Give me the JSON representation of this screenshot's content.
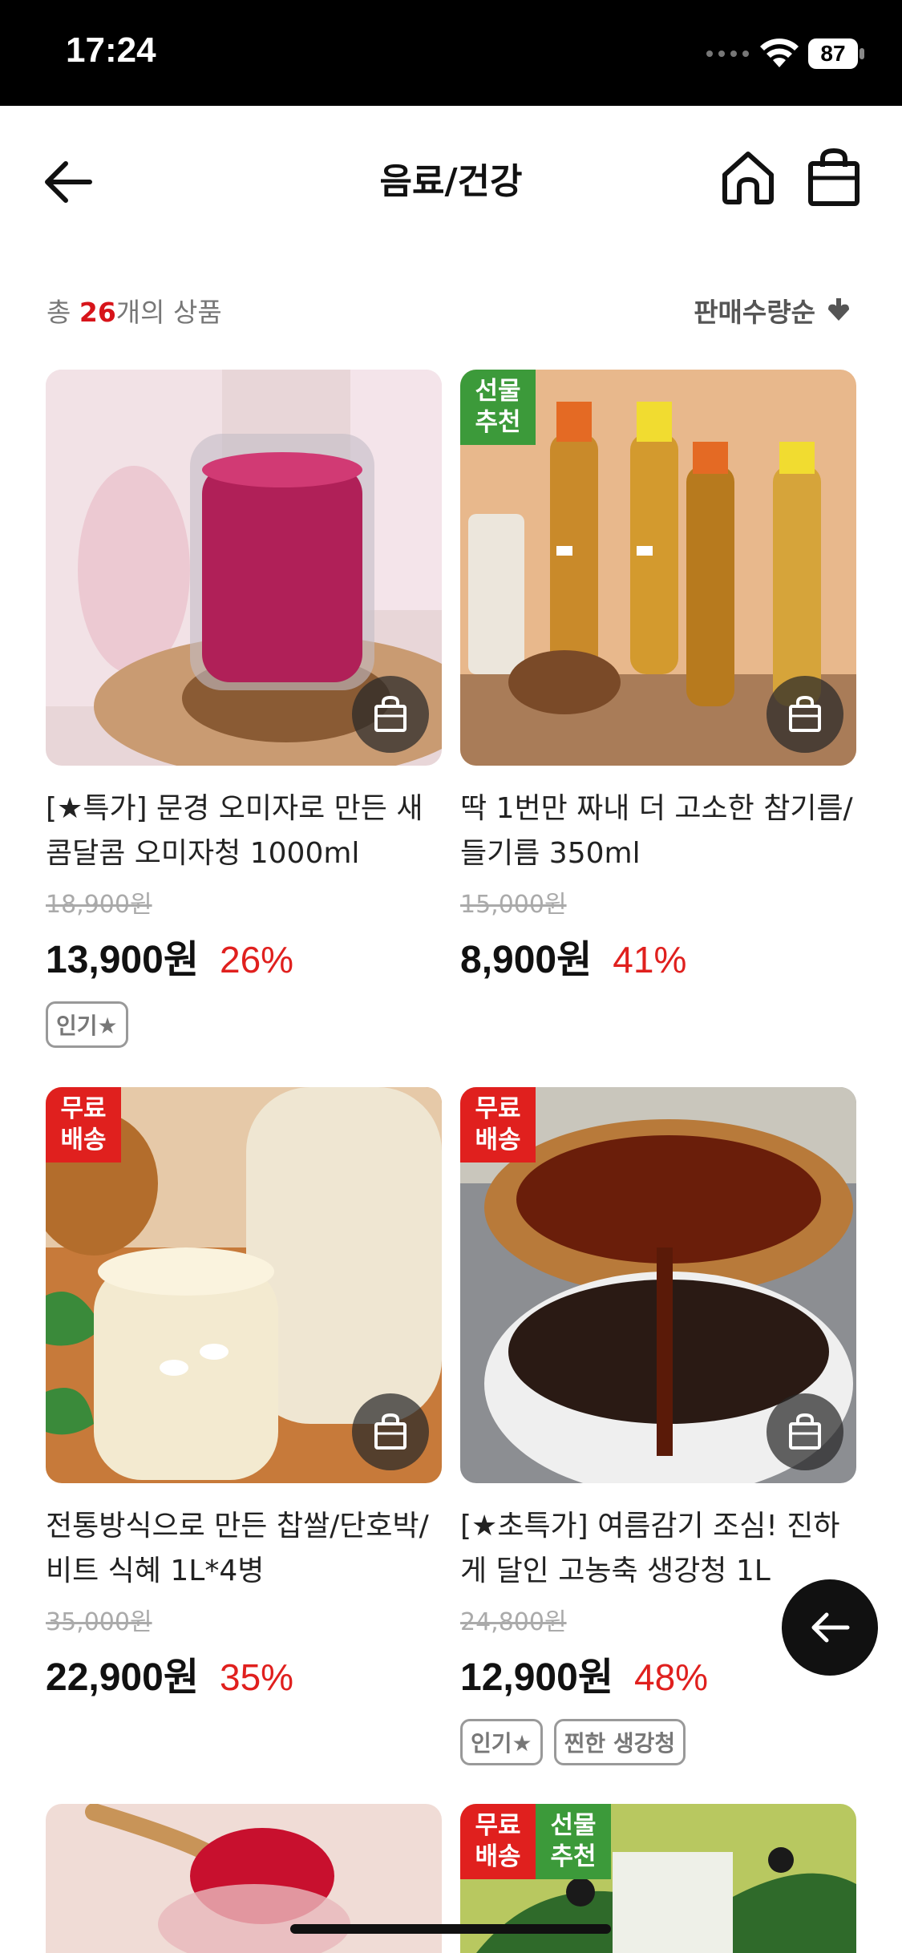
{
  "status": {
    "time": "17:24",
    "battery": "87"
  },
  "nav": {
    "title": "음료/건강",
    "back_icon": "arrow-left-icon",
    "home_icon": "home-icon",
    "bag_icon": "shopping-bag-icon"
  },
  "summary": {
    "prefix": "총 ",
    "count": "26",
    "suffix": "개의 상품"
  },
  "sort": {
    "label": "판매수량순"
  },
  "colors": {
    "accent": "#d7141a",
    "badge_red": "#e0201e",
    "badge_green": "#3c9a3a"
  },
  "products": [
    {
      "badges": [],
      "name": "[★특가] 문경 오미자로 만든 새콤달콤 오미자청 1000ml",
      "original_price": "18,900원",
      "price": "13,900원",
      "discount": "26%",
      "tags": [
        "인기★"
      ]
    },
    {
      "badges": [
        {
          "text": "선물\n추천",
          "color": "green"
        }
      ],
      "name": "딱 1번만 짜내 더 고소한 참기름/들기름 350ml",
      "original_price": "15,000원",
      "price": "8,900원",
      "discount": "41%",
      "tags": []
    },
    {
      "badges": [
        {
          "text": "무료\n배송",
          "color": "red"
        }
      ],
      "name": "전통방식으로 만든 찹쌀/단호박/비트 식혜 1L*4병",
      "original_price": "35,000원",
      "price": "22,900원",
      "discount": "35%",
      "tags": []
    },
    {
      "badges": [
        {
          "text": "무료\n배송",
          "color": "red"
        }
      ],
      "name": "[★초특가] 여름감기 조심! 진하게 달인 고농축 생강청 1L",
      "original_price": "24,800원",
      "price": "12,900원",
      "discount": "48%",
      "tags": [
        "인기★",
        "찐한 생강청"
      ]
    },
    {
      "badges": [],
      "name": "",
      "original_price": "",
      "price": "",
      "discount": "",
      "tags": []
    },
    {
      "badges": [
        {
          "text": "무료\n배송",
          "color": "red"
        },
        {
          "text": "선물\n추천",
          "color": "green"
        }
      ],
      "name": "",
      "original_price": "",
      "price": "",
      "discount": "",
      "tags": []
    }
  ]
}
